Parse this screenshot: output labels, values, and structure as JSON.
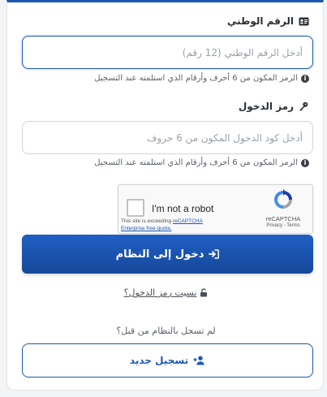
{
  "national_id": {
    "label": "الرقم الوطني",
    "placeholder": "أدخل الرقم الوطني (12 رقم)",
    "hint": "الرمز المكون من 6 أحرف وأرقام الذي استلمته عند التسجيل",
    "icon": "id-card-icon"
  },
  "login_code": {
    "label": "رمز الدخول",
    "placeholder": "أدخل كود الدخول المكون من 6 حروف",
    "hint": "الرمز المكون من 6 أحرف وأرقام الذي استلمته عند التسجيل",
    "icon": "key-icon"
  },
  "recaptcha": {
    "checkbox_label": "I'm not a robot",
    "warning_prefix": "This site is exceeding",
    "warning_link": "reCAPTCHA Enterprise free quota.",
    "brand": "reCAPTCHA",
    "links": "Privacy - Terms"
  },
  "login_button": {
    "label": "دخول إلى النظام",
    "icon": "sign-in-icon"
  },
  "forgot_link": {
    "label": "نسيت رمز الدخول؟",
    "icon": "unlock-icon"
  },
  "register": {
    "question": "لم تسجل بالنظام من قبل؟",
    "button_label": "تسجيل جديد",
    "icon": "user-plus-icon"
  },
  "colors": {
    "primary": "#1c57b5",
    "primary_dark": "#16489a",
    "border": "#cfd6de"
  }
}
